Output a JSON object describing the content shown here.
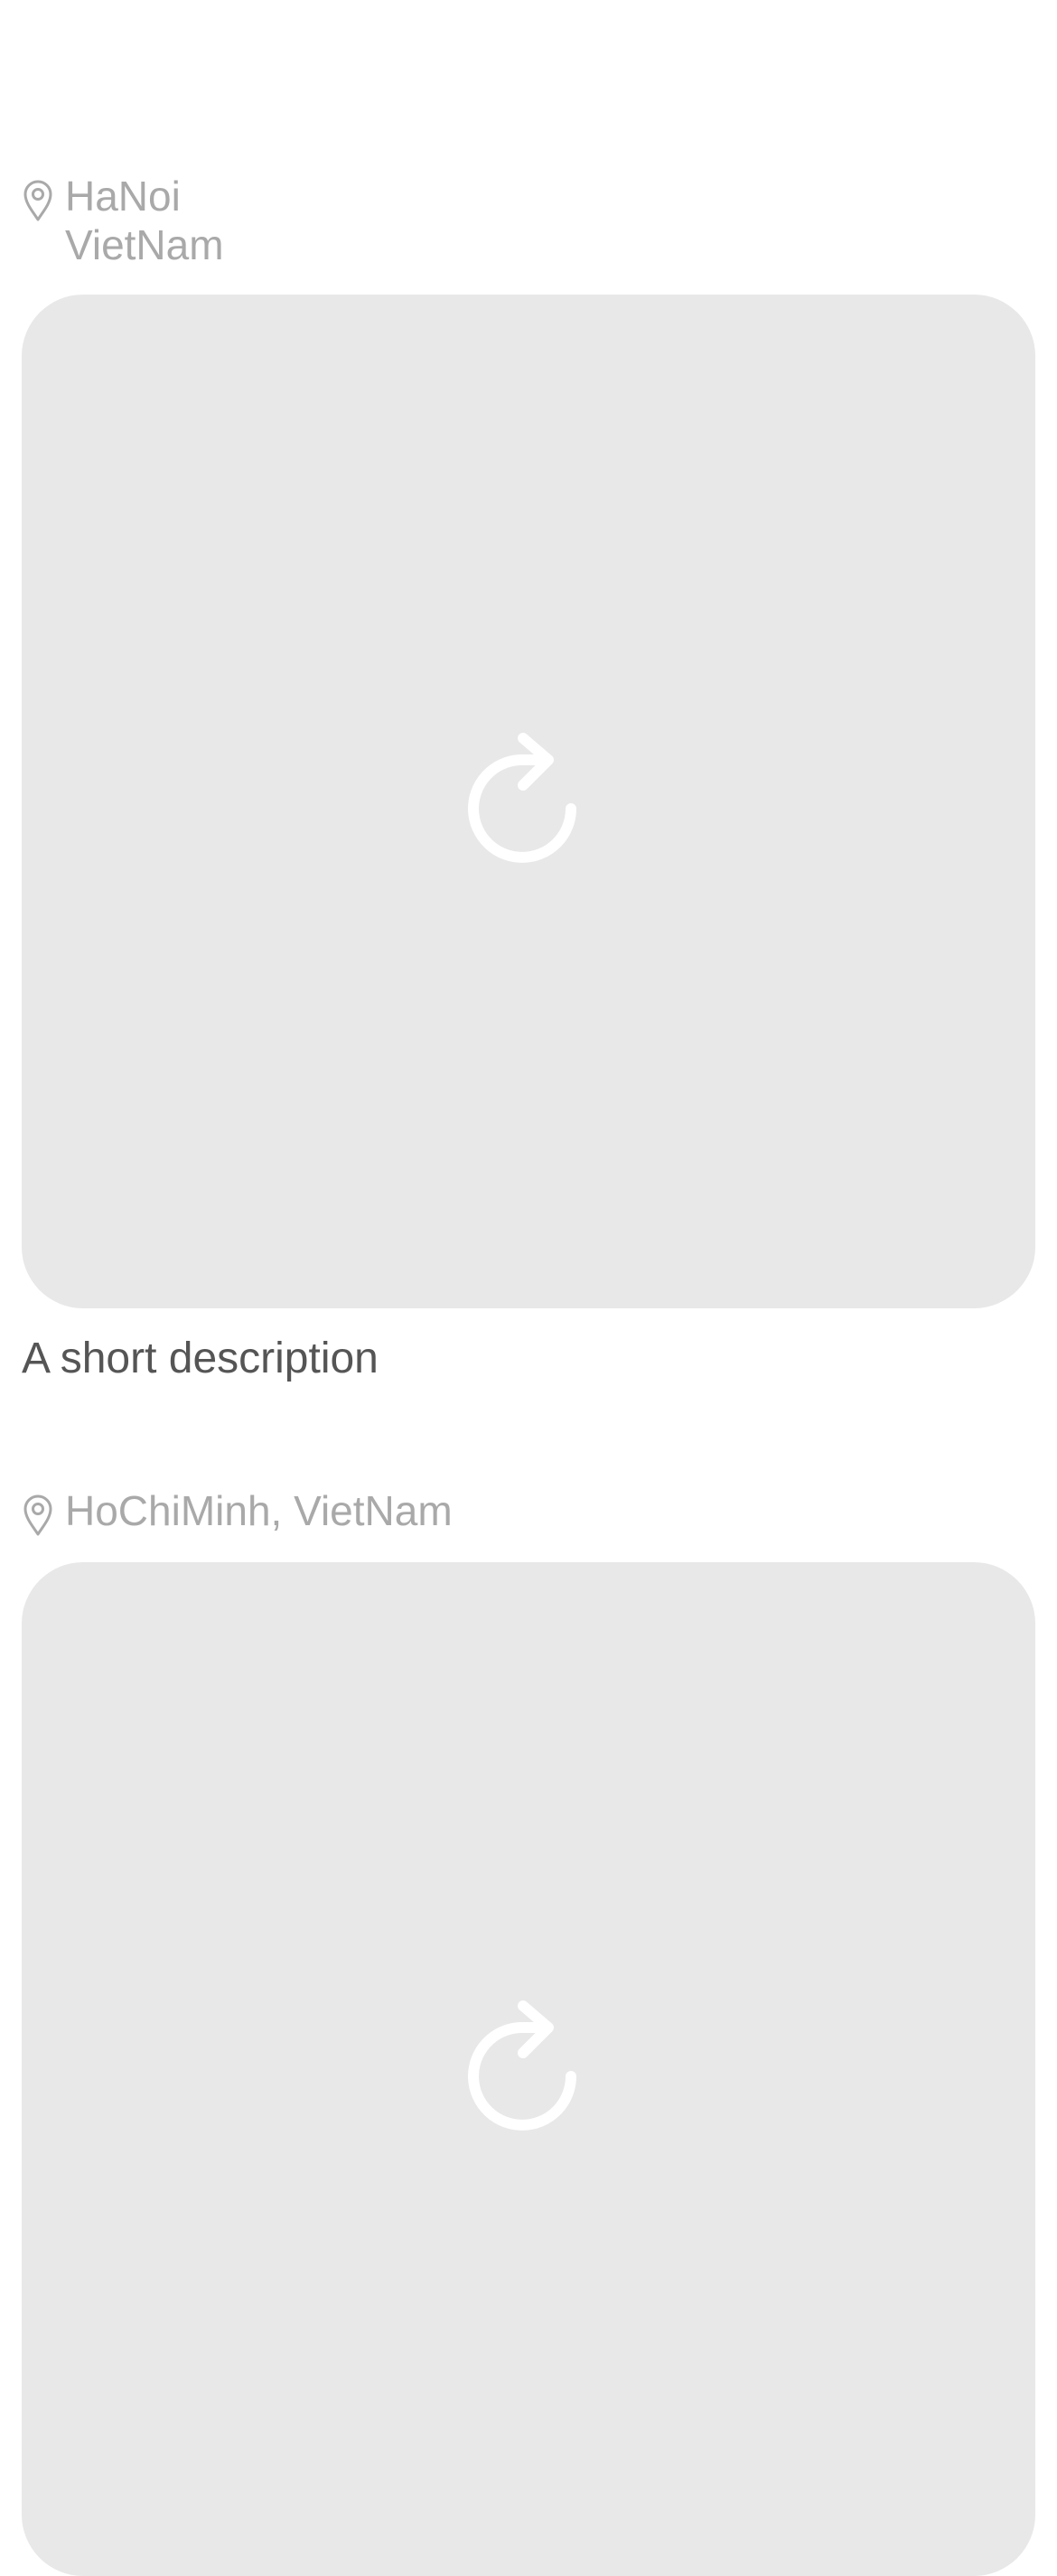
{
  "posts": [
    {
      "location_lines": [
        "HaNoi",
        "VietNam"
      ],
      "photo_icon": "reload-icon",
      "description": "A short description"
    },
    {
      "location": "HoChiMinh, VietNam",
      "photo_icon": "reload-icon"
    }
  ],
  "colors": {
    "background": "#ffffff",
    "placeholder": "#e8e8e8",
    "location_text": "#a9a9a9",
    "description_text": "#555555",
    "icon_on_placeholder": "#ffffff"
  },
  "icons": {
    "location": "map-pin-icon",
    "reload": "reload-icon"
  }
}
